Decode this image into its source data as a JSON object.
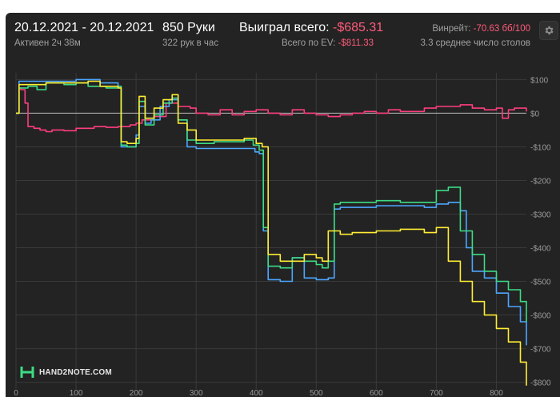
{
  "header": {
    "date_range": "20.12.2021 - 20.12.2021",
    "active": "Активен 2ч 38м",
    "hands": "850 Руки",
    "hands_per_hour": "322 рук в час",
    "won_label": "Выиграл всего:",
    "won_value": "-$685.31",
    "ev_label": "Всего по EV:",
    "ev_value": "-$811.33",
    "winrate_label": "Винрейт:",
    "winrate_value": "-70.63 бб/100",
    "tables": "3.3 среднее число столов"
  },
  "logo_text": "HAND2NOTE.COM",
  "colors": {
    "background": "#232323",
    "grid": "#3a3a3a",
    "zero_line": "#bdbdbd",
    "negative_text": "#ff5b7a"
  },
  "icons": [
    "gear-icon",
    "hand2note-logo-icon"
  ],
  "chart_data": {
    "type": "line",
    "title": "",
    "xlabel": "",
    "ylabel": "",
    "xlim": [
      0,
      850
    ],
    "ylim": [
      -820,
      120
    ],
    "xticks": [
      "0",
      "100",
      "200",
      "300",
      "400",
      "500",
      "600",
      "700",
      "800"
    ],
    "yticks": [
      "$100",
      "$0",
      "-$100",
      "-$200",
      "-$300",
      "-$400",
      "-$500",
      "-$600",
      "-$700",
      "-$800"
    ],
    "grid": true,
    "series": [
      {
        "color": "#ff3d7f",
        "x": [
          0,
          5,
          8,
          15,
          20,
          30,
          40,
          50,
          60,
          80,
          100,
          130,
          150,
          170,
          190,
          200,
          210,
          230,
          250,
          270,
          290,
          300,
          320,
          340,
          360,
          380,
          400,
          420,
          440,
          460,
          480,
          500,
          520,
          540,
          560,
          580,
          600,
          620,
          640,
          660,
          680,
          700,
          720,
          740,
          760,
          780,
          800,
          810,
          820,
          830,
          850
        ],
        "y": [
          0,
          75,
          70,
          30,
          -40,
          -45,
          -50,
          -55,
          -50,
          -52,
          -45,
          -40,
          -42,
          -40,
          -35,
          -30,
          -20,
          -10,
          30,
          20,
          15,
          0,
          -5,
          10,
          -5,
          5,
          10,
          0,
          -5,
          10,
          0,
          -5,
          -10,
          -5,
          0,
          5,
          0,
          10,
          5,
          5,
          15,
          20,
          20,
          25,
          15,
          10,
          15,
          -15,
          10,
          15,
          5
        ]
      },
      {
        "color": "#4da6ff",
        "x": [
          0,
          5,
          20,
          50,
          80,
          100,
          120,
          140,
          170,
          175,
          190,
          200,
          205,
          215,
          225,
          240,
          255,
          270,
          285,
          300,
          330,
          380,
          398,
          405,
          412,
          420,
          440,
          460,
          480,
          500,
          510,
          520,
          530,
          540,
          560,
          600,
          640,
          680,
          700,
          720,
          740,
          750,
          760,
          780,
          800,
          820,
          840,
          850
        ],
        "y": [
          0,
          95,
          95,
          95,
          95,
          100,
          100,
          90,
          80,
          -100,
          -100,
          -65,
          20,
          -30,
          -20,
          20,
          40,
          -20,
          -100,
          -105,
          -105,
          -105,
          -115,
          -120,
          -350,
          -495,
          -500,
          -430,
          -490,
          -495,
          -495,
          -490,
          -285,
          -280,
          -280,
          -275,
          -275,
          -280,
          -270,
          -265,
          -290,
          -400,
          -470,
          -490,
          -535,
          -575,
          -620,
          -690
        ]
      },
      {
        "color": "#3ddc84",
        "x": [
          0,
          5,
          20,
          35,
          50,
          80,
          100,
          120,
          150,
          170,
          175,
          185,
          200,
          205,
          215,
          230,
          245,
          260,
          270,
          285,
          300,
          330,
          380,
          395,
          405,
          412,
          420,
          440,
          460,
          480,
          500,
          510,
          520,
          530,
          540,
          560,
          600,
          640,
          680,
          700,
          720,
          740,
          760,
          780,
          800,
          820,
          840,
          850
        ],
        "y": [
          0,
          75,
          80,
          70,
          90,
          85,
          90,
          80,
          75,
          80,
          -95,
          -100,
          -90,
          35,
          -35,
          -5,
          30,
          45,
          -20,
          -80,
          -90,
          -85,
          -80,
          -95,
          -110,
          -340,
          -455,
          -460,
          -430,
          -440,
          -450,
          -460,
          -440,
          -270,
          -265,
          -265,
          -260,
          -265,
          -265,
          -230,
          -220,
          -350,
          -420,
          -470,
          -500,
          -525,
          -560,
          -620
        ]
      },
      {
        "color": "#ffee33",
        "x": [
          0,
          5,
          20,
          50,
          80,
          100,
          120,
          140,
          170,
          175,
          185,
          200,
          205,
          215,
          230,
          245,
          260,
          270,
          285,
          300,
          330,
          380,
          400,
          410,
          420,
          440,
          460,
          480,
          500,
          510,
          520,
          540,
          560,
          600,
          640,
          680,
          700,
          720,
          740,
          760,
          780,
          800,
          820,
          840,
          850
        ],
        "y": [
          0,
          85,
          85,
          90,
          90,
          90,
          95,
          80,
          75,
          -85,
          -90,
          -75,
          50,
          -15,
          15,
          40,
          55,
          -30,
          -50,
          -80,
          -80,
          -75,
          -90,
          -100,
          -420,
          -440,
          -440,
          -420,
          -430,
          -440,
          -350,
          -360,
          -355,
          -350,
          -345,
          -355,
          -340,
          -440,
          -500,
          -560,
          -600,
          -640,
          -680,
          -740,
          -810
        ]
      }
    ]
  }
}
